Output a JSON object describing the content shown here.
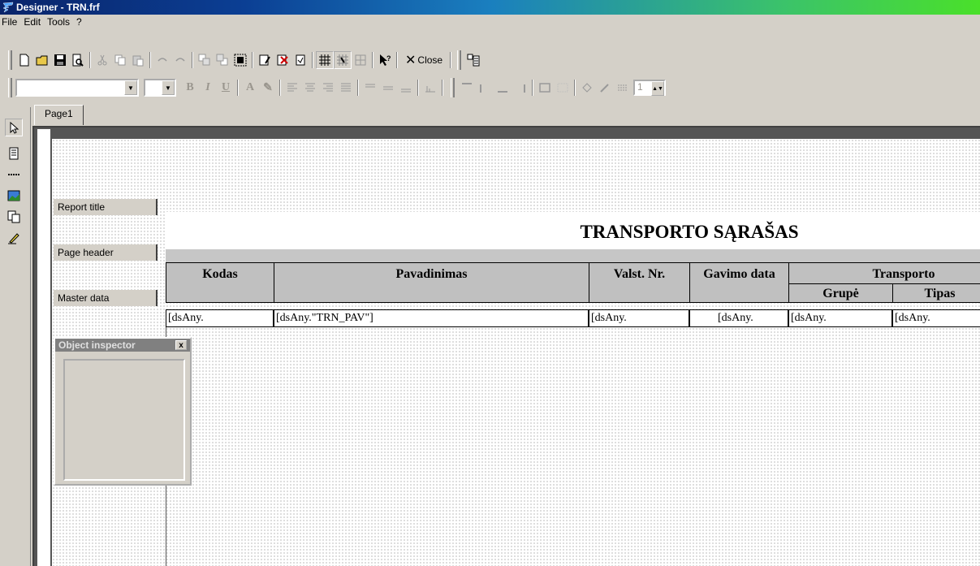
{
  "window": {
    "title": "Designer - TRN.frf"
  },
  "menu": [
    "File",
    "Edit",
    "Tools",
    "?"
  ],
  "toolbar": {
    "close_label": "Close"
  },
  "format_toolbar": {
    "font_name": "",
    "font_size": "",
    "frame_width": "1"
  },
  "tabs": [
    {
      "label": "Page1"
    }
  ],
  "bands": {
    "report_title": "Report title",
    "page_header": "Page header",
    "master_data": "Master data"
  },
  "report": {
    "title": "TRANSPORTO SĄRAŠAS",
    "columns": {
      "kodas": "Kodas",
      "pavadinimas": "Pavadinimas",
      "valst_nr": "Valst. Nr.",
      "gavimo_data": "Gavimo data",
      "transporto": "Transporto",
      "grupe": "Grupė",
      "tipas": "Tipas"
    },
    "fields": {
      "kodas": "[dsAny.",
      "pavadinimas": "[dsAny.\"TRN_PAV\"]",
      "valst_nr": "[dsAny.",
      "gavimo_data": "[dsAny.",
      "grupe": "[dsAny.",
      "tipas": "[dsAny."
    }
  },
  "inspector": {
    "title": "Object inspector",
    "close": "x"
  }
}
